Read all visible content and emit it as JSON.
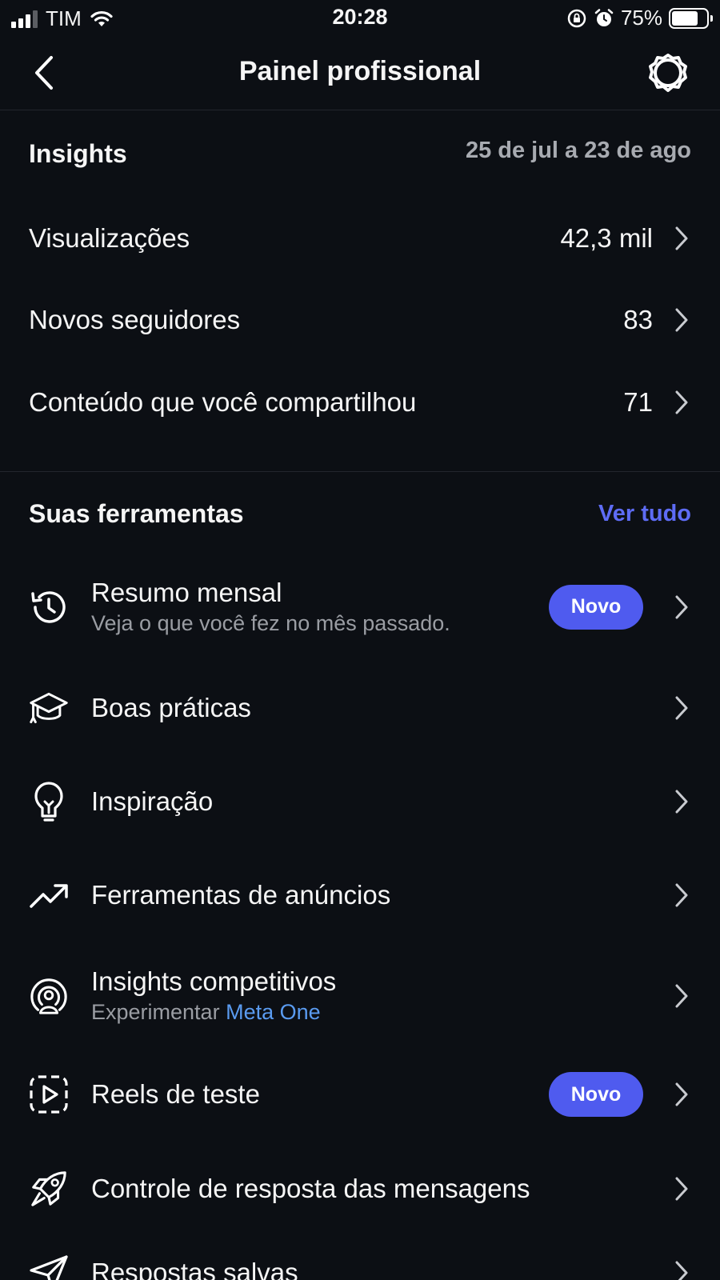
{
  "status_bar": {
    "carrier": "TIM",
    "time": "20:28",
    "battery": "75%",
    "battery_level": 0.75
  },
  "header": {
    "title": "Painel profissional"
  },
  "insights": {
    "title": "Insights",
    "date_range": "25 de jul a 23 de ago",
    "metrics": [
      {
        "label": "Visualizações",
        "value": "42,3 mil"
      },
      {
        "label": "Novos seguidores",
        "value": "83"
      },
      {
        "label": "Conteúdo que você compartilhou",
        "value": "71"
      }
    ]
  },
  "tools": {
    "title": "Suas ferramentas",
    "see_all": "Ver tudo",
    "items": [
      {
        "title": "Resumo mensal",
        "subtitle": "Veja o que você fez no mês passado.",
        "badge": "Novo",
        "icon": "history-icon"
      },
      {
        "title": "Boas práticas",
        "icon": "graduation-cap-icon"
      },
      {
        "title": "Inspiração",
        "icon": "lightbulb-icon"
      },
      {
        "title": "Ferramentas de anúncios",
        "icon": "trending-up-icon"
      },
      {
        "title": "Insights competitivos",
        "subtitle_prefix": "Experimentar",
        "subtitle_link": "Meta One",
        "icon": "radar-person-icon"
      },
      {
        "title": "Reels de teste",
        "badge": "Novo",
        "icon": "reels-test-icon"
      },
      {
        "title": "Controle de resposta das mensagens",
        "icon": "rocket-icon"
      },
      {
        "title": "Respostas salvas",
        "icon": "send-icon"
      }
    ]
  },
  "colors": {
    "background": "#0c0f14",
    "accent": "#4f5bef",
    "link": "#5a9bf0",
    "secondary_text": "#9a9da3"
  }
}
